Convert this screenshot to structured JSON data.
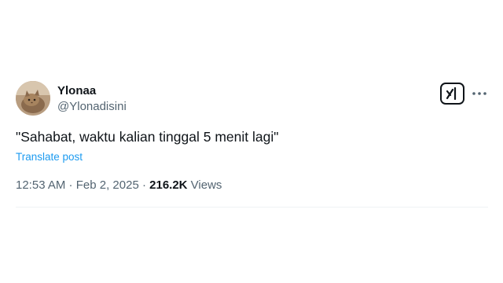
{
  "author": {
    "display_name": "Ylonaa",
    "handle": "@Ylonadisini"
  },
  "tweet": {
    "text": "\"Sahabat, waktu kalian tinggal 5 menit lagi\"",
    "translate_label": "Translate post"
  },
  "meta": {
    "time": "12:53 AM",
    "separator": " · ",
    "date": "Feb 2, 2025",
    "views_count": "216.2K",
    "views_label": " Views"
  },
  "icons": {
    "avatar": "cat-photo-avatar",
    "grok": "grok-icon",
    "more": "more-horizontal-icon"
  },
  "colors": {
    "text_primary": "#0f1419",
    "text_secondary": "#536471",
    "link": "#1d9bf0",
    "divider": "#eff3f4"
  }
}
